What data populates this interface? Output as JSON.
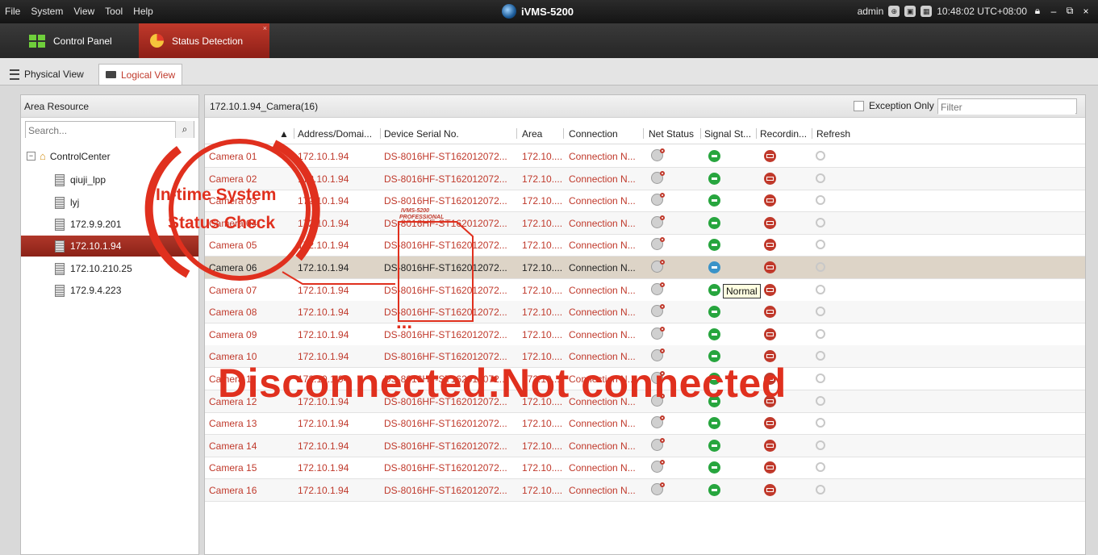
{
  "titlebar": {
    "menu": [
      "File",
      "System",
      "View",
      "Tool",
      "Help"
    ],
    "app_title": "iVMS-5200",
    "user": "admin",
    "time": "10:48:02 UTC+08:00"
  },
  "main_tabs": {
    "control_panel": "Control Panel",
    "status_detection": "Status Detection"
  },
  "sub_tabs": {
    "physical": "Physical View",
    "logical": "Logical View"
  },
  "left_panel": {
    "header": "Area Resource",
    "search_placeholder": "Search...",
    "root": "ControlCenter",
    "items": [
      "qiuji_lpp",
      "lyj",
      "172.9.9.201",
      "172.10.1.94",
      "172.10.210.25",
      "172.9.4.223"
    ],
    "selected_item": "172.10.1.94"
  },
  "right_panel": {
    "title": "172.10.1.94_Camera(16)",
    "exception_only": "Exception Only",
    "filter_placeholder": "Filter",
    "columns": [
      "Address/Domai...",
      "Device Serial No.",
      "Area",
      "Connection",
      "Net Status",
      "Signal St...",
      "Recordin...",
      "Refresh"
    ],
    "rows": [
      {
        "name": "Camera 01",
        "address": "172.10.1.94",
        "serial": "DS-8016HF-ST162012072...",
        "area": "172.10....",
        "connection": "Connection N..."
      },
      {
        "name": "Camera 02",
        "address": "172.10.1.94",
        "serial": "DS-8016HF-ST162012072...",
        "area": "172.10....",
        "connection": "Connection N..."
      },
      {
        "name": "Camera 03",
        "address": "172.10.1.94",
        "serial": "DS-8016HF-ST162012072...",
        "area": "172.10....",
        "connection": "Connection N..."
      },
      {
        "name": "Camera 04",
        "address": "172.10.1.94",
        "serial": "DS-8016HF-ST162012072...",
        "area": "172.10....",
        "connection": "Connection N..."
      },
      {
        "name": "Camera 05",
        "address": "172.10.1.94",
        "serial": "DS-8016HF-ST162012072...",
        "area": "172.10....",
        "connection": "Connection N..."
      },
      {
        "name": "Camera 06",
        "address": "172.10.1.94",
        "serial": "DS-8016HF-ST162012072...",
        "area": "172.10....",
        "connection": "Connection N..."
      },
      {
        "name": "Camera 07",
        "address": "172.10.1.94",
        "serial": "DS-8016HF-ST162012072...",
        "area": "172.10....",
        "connection": "Connection N..."
      },
      {
        "name": "Camera 08",
        "address": "172.10.1.94",
        "serial": "DS-8016HF-ST162012072...",
        "area": "172.10....",
        "connection": "Connection N..."
      },
      {
        "name": "Camera 09",
        "address": "172.10.1.94",
        "serial": "DS-8016HF-ST162012072...",
        "area": "172.10....",
        "connection": "Connection N..."
      },
      {
        "name": "Camera 10",
        "address": "172.10.1.94",
        "serial": "DS-8016HF-ST162012072...",
        "area": "172.10....",
        "connection": "Connection N..."
      },
      {
        "name": "Camera 11",
        "address": "172.10.1.94",
        "serial": "DS-8016HF-ST162012072...",
        "area": "172.10....",
        "connection": "Connection N..."
      },
      {
        "name": "Camera 12",
        "address": "172.10.1.94",
        "serial": "DS-8016HF-ST162012072...",
        "area": "172.10....",
        "connection": "Connection N..."
      },
      {
        "name": "Camera 13",
        "address": "172.10.1.94",
        "serial": "DS-8016HF-ST162012072...",
        "area": "172.10....",
        "connection": "Connection N..."
      },
      {
        "name": "Camera 14",
        "address": "172.10.1.94",
        "serial": "DS-8016HF-ST162012072...",
        "area": "172.10....",
        "connection": "Connection N..."
      },
      {
        "name": "Camera 15",
        "address": "172.10.1.94",
        "serial": "DS-8016HF-ST162012072...",
        "area": "172.10....",
        "connection": "Connection N..."
      },
      {
        "name": "Camera 16",
        "address": "172.10.1.94",
        "serial": "DS-8016HF-ST162012072...",
        "area": "172.10....",
        "connection": "Connection N..."
      }
    ],
    "selected_row": "Camera 06",
    "tooltip": "Normal"
  },
  "overlay": {
    "circle_line1": "In-time System",
    "circle_line2": "Status Check",
    "banner": "Disconnected:Not connected",
    "badge_line1": "IVMS-5200",
    "badge_line2": "PROFESSIONAL",
    "dots": "...",
    "accent_color": "#e0301e"
  }
}
